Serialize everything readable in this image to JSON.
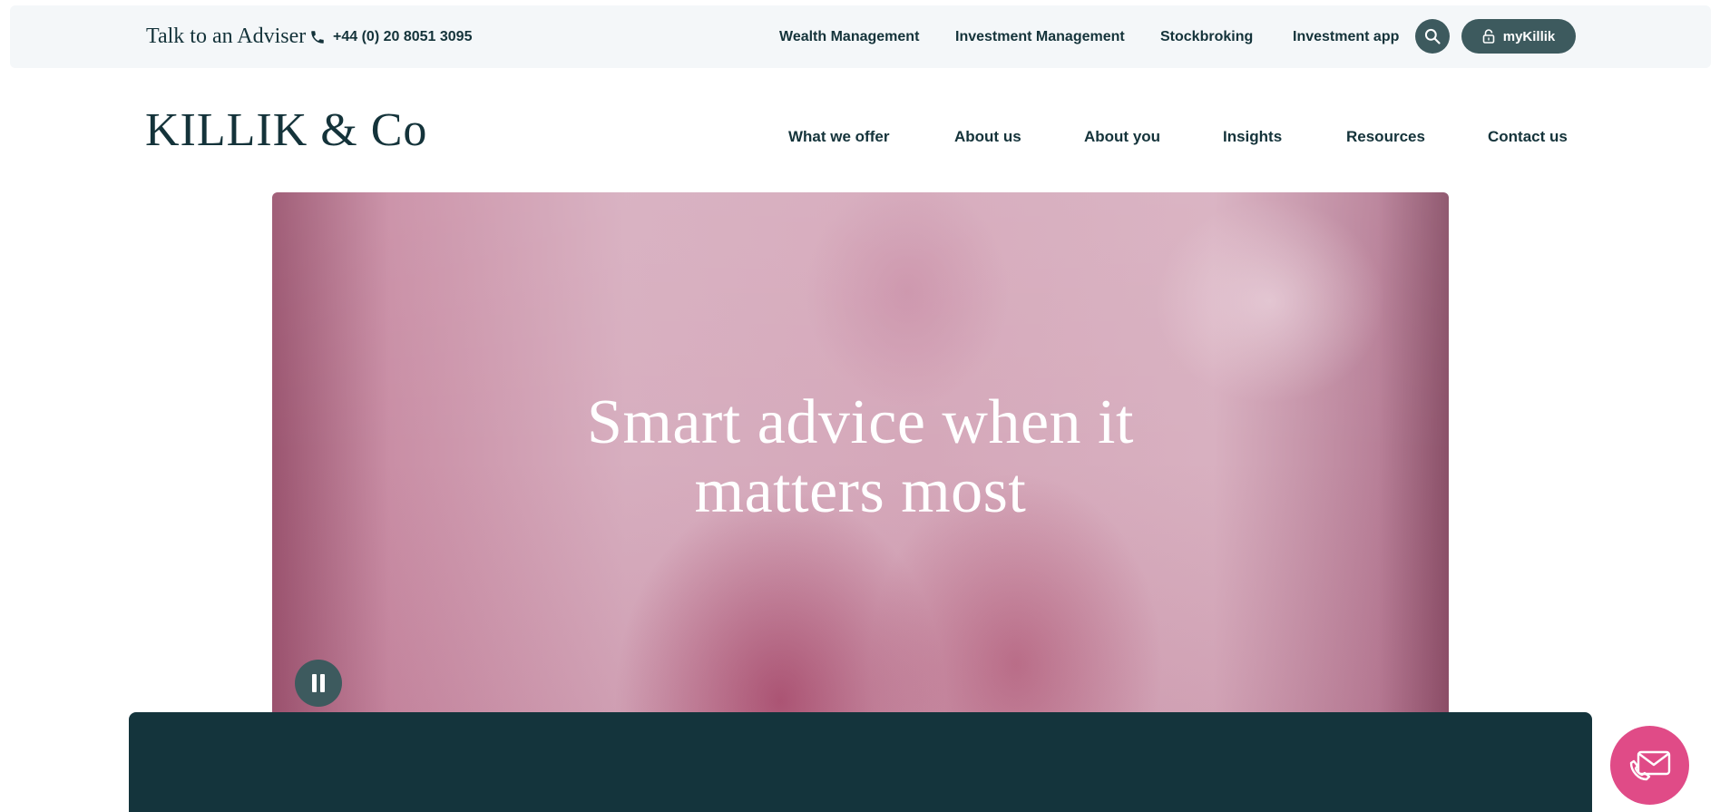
{
  "topbar": {
    "talk_label": "Talk to an Adviser",
    "phone": "+44 (0) 20 8051 3095",
    "links": [
      {
        "label": "Wealth Management"
      },
      {
        "label": "Investment Management"
      },
      {
        "label": "Stockbroking"
      },
      {
        "label": "Investment app"
      }
    ],
    "account_label": "myKillik",
    "search_icon": "search-icon",
    "lock_icon": "lock-icon"
  },
  "header": {
    "logo": "KILLIK & Co",
    "nav": [
      {
        "label": "What we offer"
      },
      {
        "label": "About us"
      },
      {
        "label": "About you"
      },
      {
        "label": "Insights"
      },
      {
        "label": "Resources"
      },
      {
        "label": "Contact us"
      }
    ]
  },
  "hero": {
    "title_line1": "Smart advice when it",
    "title_line2": "matters most",
    "pause_icon": "pause-icon"
  },
  "contact_fab": {
    "icon": "phone-envelope-icon"
  },
  "colors": {
    "text": "#14333a",
    "topbar_bg": "#f4f7f9",
    "button_bg": "#3d5a5e",
    "panel_bg": "#14343c",
    "accent_pink": "#e04b87"
  }
}
